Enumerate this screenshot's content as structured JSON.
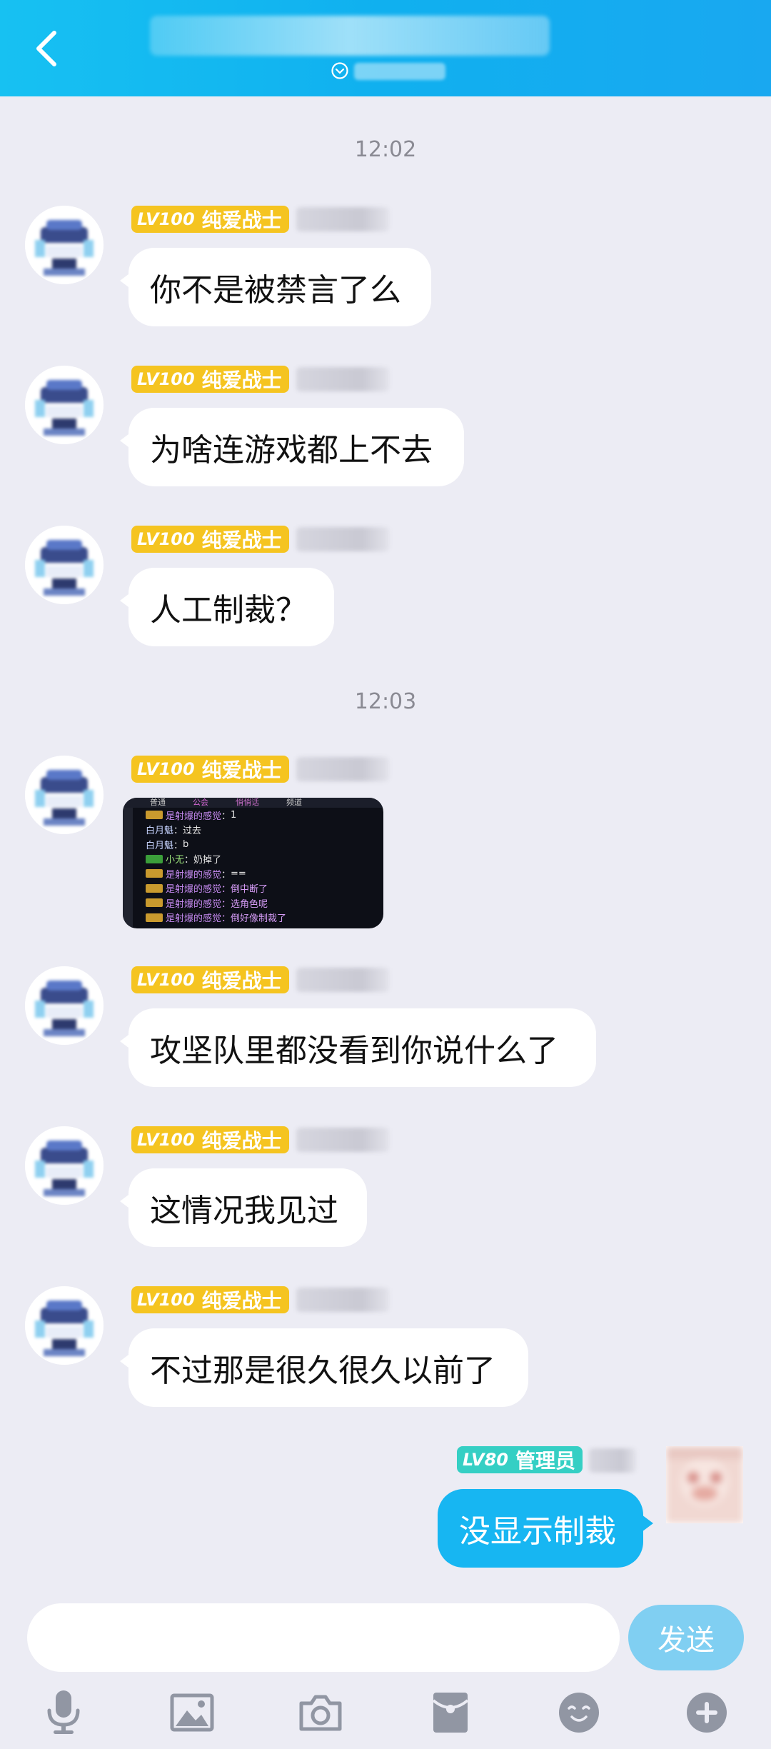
{
  "header": {
    "back_icon": "chevron-left-icon",
    "title": "",
    "subtitle_icon": "chevron-down-circle-icon",
    "gradient": [
      "#17c1f2",
      "#19a8f0"
    ]
  },
  "timestamps": [
    "12:02",
    "12:03"
  ],
  "member_tag": {
    "level": "LV100",
    "title": "纯爱战士",
    "color": "#f5c420"
  },
  "messages": [
    {
      "text": "你不是被禁言了么"
    },
    {
      "text": "为啥连游戏都上不去"
    },
    {
      "text": "人工制裁？"
    },
    {
      "text": "攻坚队里都没看到你说什么了"
    },
    {
      "text": "这情况我见过"
    },
    {
      "text": "不过那是很久很久以前了"
    }
  ],
  "image_message": {
    "tabs": [
      "普通",
      "公会",
      "悄悄话",
      "频道"
    ],
    "lines": [
      {
        "name": "是射爆的感觉",
        "sep": "：",
        "text": "1"
      },
      {
        "name": "白月魁",
        "sep": "：",
        "text": "过去"
      },
      {
        "name": "白月魁",
        "sep": "：",
        "text": "b"
      },
      {
        "name": "小无",
        "sep": "：",
        "text": "奶掉了"
      },
      {
        "name": "是射爆的感觉",
        "sep": "：",
        "text": "=="
      },
      {
        "name": "是射爆的感觉",
        "sep": "：",
        "text": "倒中断了"
      },
      {
        "name": "是射爆的感觉",
        "sep": "：",
        "text": "选角色呢"
      },
      {
        "name": "是射爆的感觉",
        "sep": "：",
        "text": "倒好像制裁了"
      }
    ]
  },
  "my_tag": {
    "level": "LV80",
    "title": "管理员",
    "color": "#35cfc4"
  },
  "my_message": {
    "text": "没显示制裁",
    "color": "#17b6f2"
  },
  "input": {
    "placeholder": ""
  },
  "send_button": {
    "label": "发送",
    "color": "#80cff2"
  },
  "toolbar": [
    "microphone-icon",
    "image-icon",
    "camera-icon",
    "red-packet-icon",
    "emoji-icon",
    "plus-icon"
  ]
}
